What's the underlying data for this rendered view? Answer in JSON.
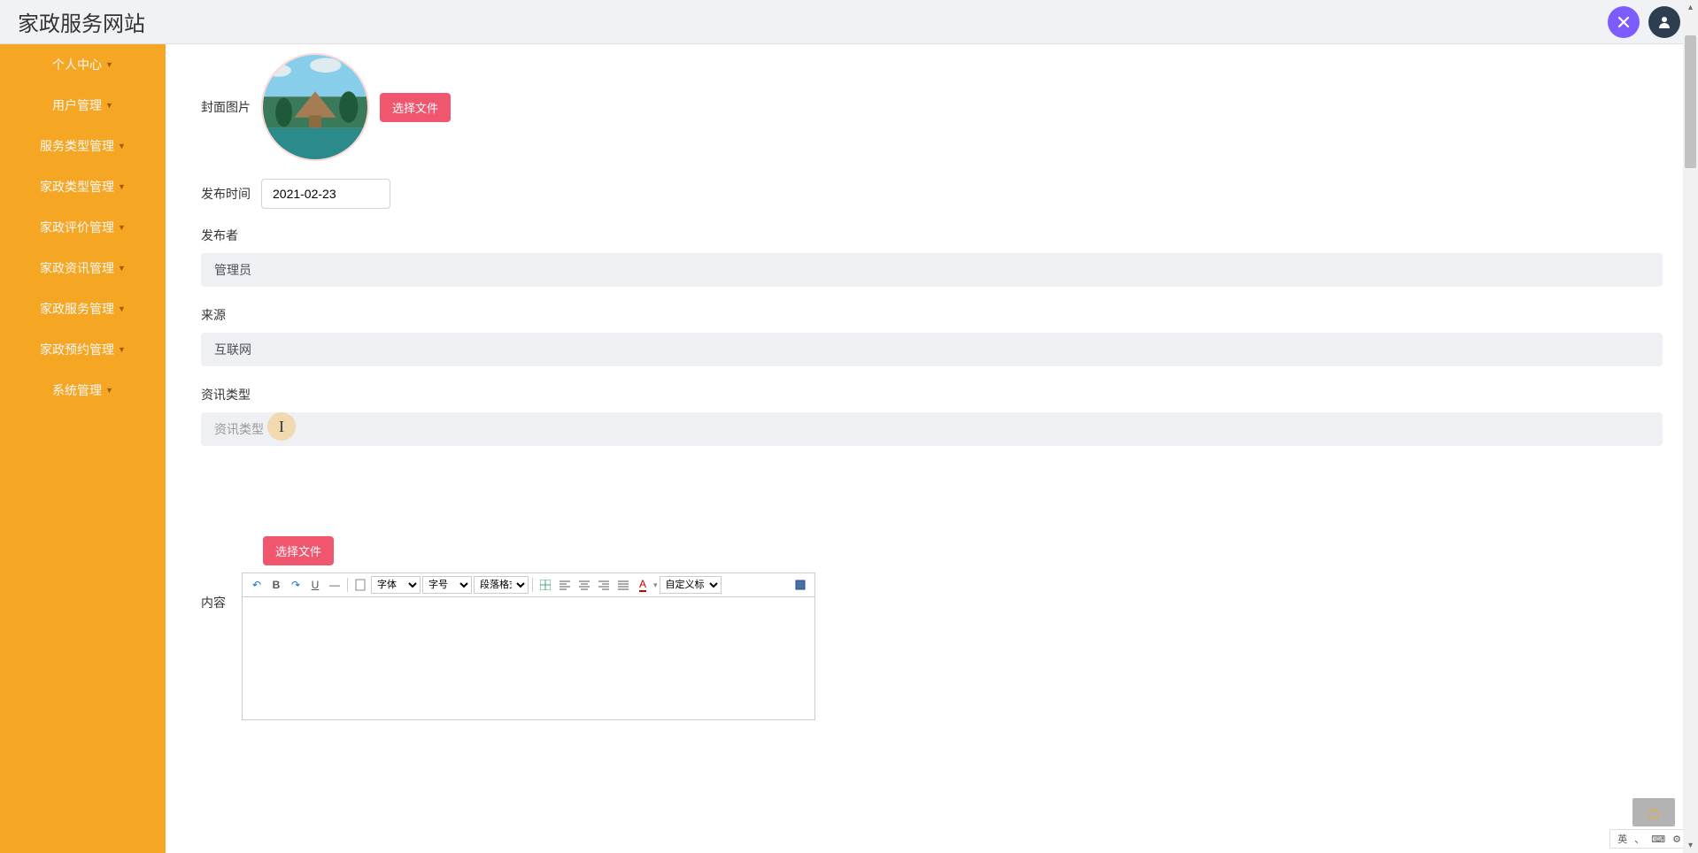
{
  "header": {
    "title": "家政服务网站"
  },
  "sidebar": {
    "items": [
      {
        "label": "个人中心"
      },
      {
        "label": "用户管理"
      },
      {
        "label": "服务类型管理"
      },
      {
        "label": "家政类型管理"
      },
      {
        "label": "家政评价管理"
      },
      {
        "label": "家政资讯管理"
      },
      {
        "label": "家政服务管理"
      },
      {
        "label": "家政预约管理"
      },
      {
        "label": "系统管理"
      }
    ]
  },
  "form": {
    "cover_label": "封面图片",
    "select_file": "选择文件",
    "publish_time_label": "发布时间",
    "publish_time_value": "2021-02-23",
    "publisher_label": "发布者",
    "publisher_value": "管理员",
    "source_label": "来源",
    "source_value": "互联网",
    "info_type_label": "资讯类型",
    "info_type_placeholder": "资讯类型",
    "content_label": "内容"
  },
  "editor": {
    "undo": "↶",
    "redo": "↷",
    "bold": "B",
    "underline": "U",
    "dash": "—",
    "font_label": "字体",
    "size_label": "字号",
    "para_label": "段落格式",
    "font_color": "A",
    "custom_title": "自定义标题"
  },
  "ime": {
    "lang": "英",
    "items": [
      "、",
      "⌨",
      "⚙"
    ]
  }
}
